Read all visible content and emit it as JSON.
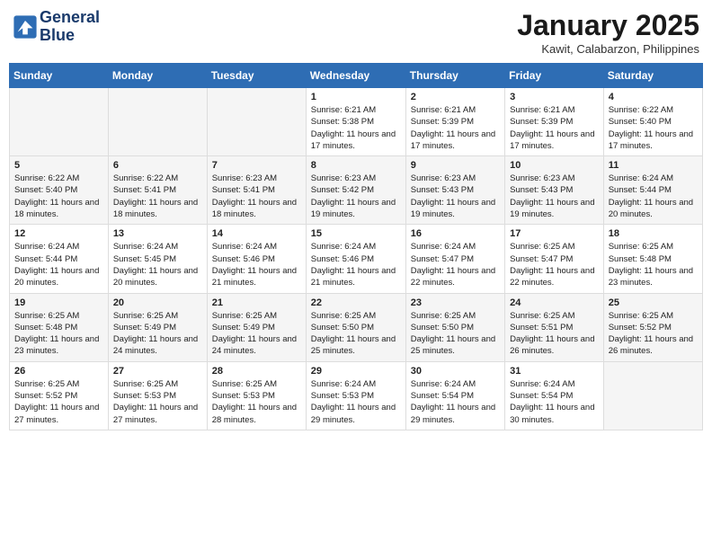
{
  "header": {
    "logo_line1": "General",
    "logo_line2": "Blue",
    "title": "January 2025",
    "subtitle": "Kawit, Calabarzon, Philippines"
  },
  "weekdays": [
    "Sunday",
    "Monday",
    "Tuesday",
    "Wednesday",
    "Thursday",
    "Friday",
    "Saturday"
  ],
  "weeks": [
    [
      {
        "day": "",
        "info": ""
      },
      {
        "day": "",
        "info": ""
      },
      {
        "day": "",
        "info": ""
      },
      {
        "day": "1",
        "info": "Sunrise: 6:21 AM\nSunset: 5:38 PM\nDaylight: 11 hours and 17 minutes."
      },
      {
        "day": "2",
        "info": "Sunrise: 6:21 AM\nSunset: 5:39 PM\nDaylight: 11 hours and 17 minutes."
      },
      {
        "day": "3",
        "info": "Sunrise: 6:21 AM\nSunset: 5:39 PM\nDaylight: 11 hours and 17 minutes."
      },
      {
        "day": "4",
        "info": "Sunrise: 6:22 AM\nSunset: 5:40 PM\nDaylight: 11 hours and 17 minutes."
      }
    ],
    [
      {
        "day": "5",
        "info": "Sunrise: 6:22 AM\nSunset: 5:40 PM\nDaylight: 11 hours and 18 minutes."
      },
      {
        "day": "6",
        "info": "Sunrise: 6:22 AM\nSunset: 5:41 PM\nDaylight: 11 hours and 18 minutes."
      },
      {
        "day": "7",
        "info": "Sunrise: 6:23 AM\nSunset: 5:41 PM\nDaylight: 11 hours and 18 minutes."
      },
      {
        "day": "8",
        "info": "Sunrise: 6:23 AM\nSunset: 5:42 PM\nDaylight: 11 hours and 19 minutes."
      },
      {
        "day": "9",
        "info": "Sunrise: 6:23 AM\nSunset: 5:43 PM\nDaylight: 11 hours and 19 minutes."
      },
      {
        "day": "10",
        "info": "Sunrise: 6:23 AM\nSunset: 5:43 PM\nDaylight: 11 hours and 19 minutes."
      },
      {
        "day": "11",
        "info": "Sunrise: 6:24 AM\nSunset: 5:44 PM\nDaylight: 11 hours and 20 minutes."
      }
    ],
    [
      {
        "day": "12",
        "info": "Sunrise: 6:24 AM\nSunset: 5:44 PM\nDaylight: 11 hours and 20 minutes."
      },
      {
        "day": "13",
        "info": "Sunrise: 6:24 AM\nSunset: 5:45 PM\nDaylight: 11 hours and 20 minutes."
      },
      {
        "day": "14",
        "info": "Sunrise: 6:24 AM\nSunset: 5:46 PM\nDaylight: 11 hours and 21 minutes."
      },
      {
        "day": "15",
        "info": "Sunrise: 6:24 AM\nSunset: 5:46 PM\nDaylight: 11 hours and 21 minutes."
      },
      {
        "day": "16",
        "info": "Sunrise: 6:24 AM\nSunset: 5:47 PM\nDaylight: 11 hours and 22 minutes."
      },
      {
        "day": "17",
        "info": "Sunrise: 6:25 AM\nSunset: 5:47 PM\nDaylight: 11 hours and 22 minutes."
      },
      {
        "day": "18",
        "info": "Sunrise: 6:25 AM\nSunset: 5:48 PM\nDaylight: 11 hours and 23 minutes."
      }
    ],
    [
      {
        "day": "19",
        "info": "Sunrise: 6:25 AM\nSunset: 5:48 PM\nDaylight: 11 hours and 23 minutes."
      },
      {
        "day": "20",
        "info": "Sunrise: 6:25 AM\nSunset: 5:49 PM\nDaylight: 11 hours and 24 minutes."
      },
      {
        "day": "21",
        "info": "Sunrise: 6:25 AM\nSunset: 5:49 PM\nDaylight: 11 hours and 24 minutes."
      },
      {
        "day": "22",
        "info": "Sunrise: 6:25 AM\nSunset: 5:50 PM\nDaylight: 11 hours and 25 minutes."
      },
      {
        "day": "23",
        "info": "Sunrise: 6:25 AM\nSunset: 5:50 PM\nDaylight: 11 hours and 25 minutes."
      },
      {
        "day": "24",
        "info": "Sunrise: 6:25 AM\nSunset: 5:51 PM\nDaylight: 11 hours and 26 minutes."
      },
      {
        "day": "25",
        "info": "Sunrise: 6:25 AM\nSunset: 5:52 PM\nDaylight: 11 hours and 26 minutes."
      }
    ],
    [
      {
        "day": "26",
        "info": "Sunrise: 6:25 AM\nSunset: 5:52 PM\nDaylight: 11 hours and 27 minutes."
      },
      {
        "day": "27",
        "info": "Sunrise: 6:25 AM\nSunset: 5:53 PM\nDaylight: 11 hours and 27 minutes."
      },
      {
        "day": "28",
        "info": "Sunrise: 6:25 AM\nSunset: 5:53 PM\nDaylight: 11 hours and 28 minutes."
      },
      {
        "day": "29",
        "info": "Sunrise: 6:24 AM\nSunset: 5:53 PM\nDaylight: 11 hours and 29 minutes."
      },
      {
        "day": "30",
        "info": "Sunrise: 6:24 AM\nSunset: 5:54 PM\nDaylight: 11 hours and 29 minutes."
      },
      {
        "day": "31",
        "info": "Sunrise: 6:24 AM\nSunset: 5:54 PM\nDaylight: 11 hours and 30 minutes."
      },
      {
        "day": "",
        "info": ""
      }
    ]
  ]
}
